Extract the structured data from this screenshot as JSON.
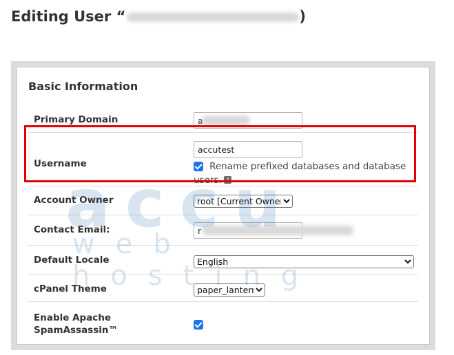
{
  "page": {
    "title_prefix": "Editing User “",
    "title_suffix": ")"
  },
  "section": {
    "title": "Basic Information"
  },
  "fields": {
    "primary_domain": {
      "label": "Primary Domain",
      "value": "a"
    },
    "username": {
      "label": "Username",
      "value": "accutest",
      "rename_checked": true,
      "rename_text": "Rename prefixed databases and database users."
    },
    "account_owner": {
      "label": "Account Owner",
      "selected": "root [Current Owner]"
    },
    "contact_email": {
      "label": "Contact Email:",
      "value": "r"
    },
    "default_locale": {
      "label": "Default Locale",
      "selected": "English"
    },
    "cpanel_theme": {
      "label": "cPanel Theme",
      "selected": "paper_lantern"
    },
    "spamassassin": {
      "label": "Enable Apache SpamAssassin™",
      "checked": true
    }
  },
  "colors": {
    "highlight": "#e00000",
    "checkbox": "#1a73e8",
    "panel_bg": "#dcdcdc"
  },
  "watermark": {
    "main": "accu",
    "sub": "web hosting"
  }
}
